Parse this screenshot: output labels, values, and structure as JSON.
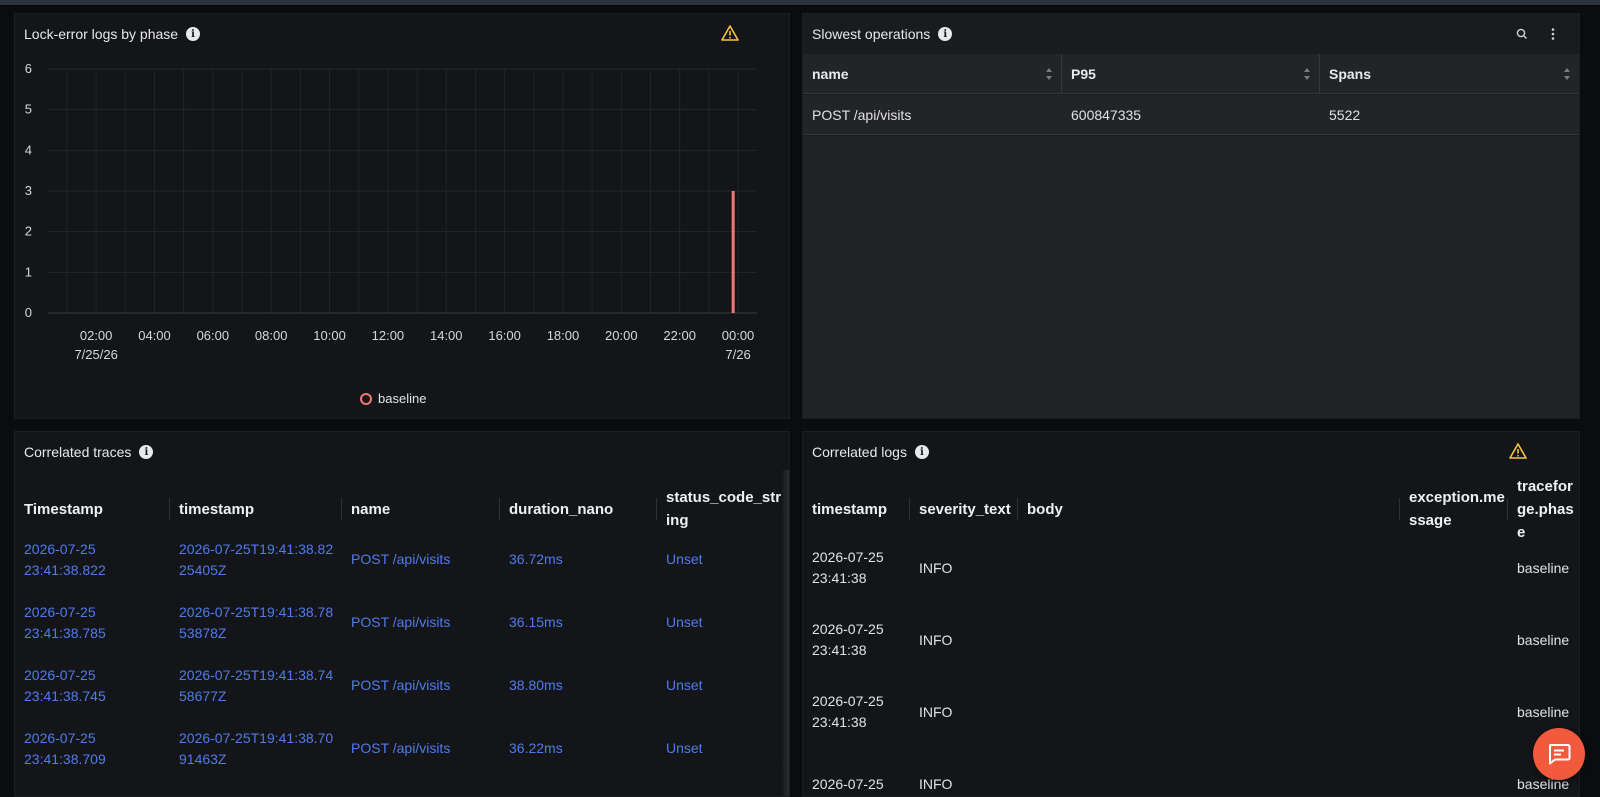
{
  "panels": {
    "lock_errors": {
      "title": "Lock-error logs by phase"
    },
    "slowest_ops": {
      "title": "Slowest operations",
      "columns": [
        "name",
        "P95",
        "Spans"
      ],
      "rows": [
        [
          "POST /api/visits",
          "600847335",
          "5522"
        ]
      ]
    },
    "traces": {
      "title": "Correlated traces",
      "columns": [
        "Timestamp",
        "timestamp",
        "name",
        "duration_nano",
        "status_code_string"
      ],
      "rows": [
        [
          "2026-07-25 23:41:38.822",
          "2026-07-25T19:41:38.8225405Z",
          "POST /api/visits",
          "36.72ms",
          "Unset"
        ],
        [
          "2026-07-25 23:41:38.785",
          "2026-07-25T19:41:38.7853878Z",
          "POST /api/visits",
          "36.15ms",
          "Unset"
        ],
        [
          "2026-07-25 23:41:38.745",
          "2026-07-25T19:41:38.7458677Z",
          "POST /api/visits",
          "38.80ms",
          "Unset"
        ],
        [
          "2026-07-25 23:41:38.709",
          "2026-07-25T19:41:38.7091463Z",
          "POST /api/visits",
          "36.22ms",
          "Unset"
        ]
      ]
    },
    "logs": {
      "title": "Correlated logs",
      "columns": [
        "timestamp",
        "severity_text",
        "body",
        "exception.message",
        "traceforge.phase"
      ],
      "rows": [
        [
          "2026-07-25 23:41:38",
          "INFO",
          "",
          "",
          "baseline"
        ],
        [
          "2026-07-25 23:41:38",
          "INFO",
          "",
          "",
          "baseline"
        ],
        [
          "2026-07-25 23:41:38",
          "INFO",
          "",
          "",
          "baseline"
        ],
        [
          "2026-07-25",
          "INFO",
          "",
          "",
          "baseline"
        ]
      ]
    }
  },
  "chart_data": {
    "type": "bar",
    "title": "Lock-error logs by phase",
    "x_tick_labels": [
      "02:00\n7/25/26",
      "04:00",
      "06:00",
      "08:00",
      "10:00",
      "12:00",
      "14:00",
      "16:00",
      "18:00",
      "20:00",
      "22:00",
      "00:00\n7/26"
    ],
    "ylim": [
      0,
      6
    ],
    "y_ticks": [
      0,
      1,
      2,
      3,
      4,
      5,
      6
    ],
    "series": [
      {
        "name": "baseline",
        "color": "#f27878",
        "points": [
          {
            "x": "7/25/26 23:50",
            "y": 3
          }
        ]
      }
    ],
    "legend": "bottom-center",
    "grid": true
  },
  "colors": {
    "accent_link": "#4f7bea",
    "warning": "#f5c542",
    "fab": "#f15a3c"
  },
  "icons": {
    "info": "info-icon",
    "warning": "warning-icon",
    "search": "search-icon",
    "menu": "more-vertical-icon",
    "chat": "chat-icon"
  }
}
